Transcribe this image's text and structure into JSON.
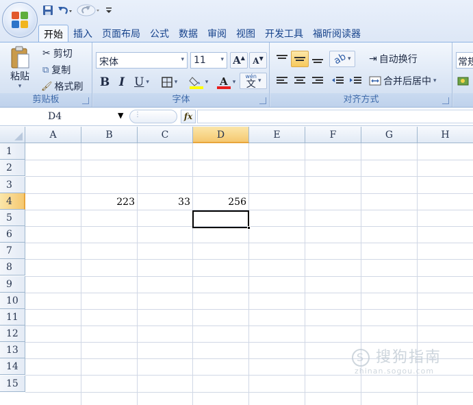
{
  "tabs": [
    "开始",
    "插入",
    "页面布局",
    "公式",
    "数据",
    "审阅",
    "视图",
    "开发工具",
    "福昕阅读器"
  ],
  "clipboard": {
    "paste": "粘贴",
    "cut": "剪切",
    "copy": "复制",
    "format_painter": "格式刷",
    "label": "剪贴板"
  },
  "font": {
    "name": "宋体",
    "size": "11",
    "bold": "B",
    "italic": "I",
    "underline": "U",
    "pinyin": "wén",
    "label": "字体"
  },
  "alignment": {
    "wrap": "自动换行",
    "merge": "合并后居中",
    "label": "对齐方式"
  },
  "number": {
    "format": "常规"
  },
  "formula_bar": {
    "name_box": "D4",
    "fx": "fx",
    "content": ""
  },
  "columns": [
    "A",
    "B",
    "C",
    "D",
    "E",
    "F",
    "G",
    "H"
  ],
  "rows": [
    "1",
    "2",
    "3",
    "4",
    "5",
    "6",
    "7",
    "8",
    "9",
    "10",
    "11",
    "12",
    "13",
    "14",
    "15"
  ],
  "cells": {
    "B3": "223",
    "C3": "33",
    "D3": "256"
  },
  "selected": {
    "cell": "D4",
    "column": "D",
    "row": "4"
  },
  "watermark": {
    "title": "搜狗指南",
    "url": "zhinan.sogou.com"
  },
  "colors": {
    "selection": "#f5c870",
    "tab_text": "#15428b",
    "group_label": "#3e6aaa"
  }
}
